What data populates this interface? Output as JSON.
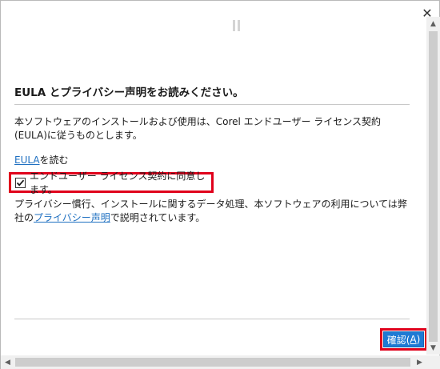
{
  "window": {
    "close_glyph": "✕"
  },
  "heading": "EULA とプライバシー声明をお読みください。",
  "description": "本ソフトウェアのインストールおよび使用は、Corel エンドユーザー ライセンス契約 (EULA)に従うものとします。",
  "eula_link": {
    "link_text": "EULA",
    "suffix": "を読む"
  },
  "agree": {
    "label": "エンドユーザー ライセンス契約に同意します。",
    "checked": true
  },
  "privacy": {
    "prefix": "プライバシー慣行、インストールに関するデータ処理、本ソフトウェアの利用については弊社の",
    "link_text": "プライバシー声明",
    "suffix": "で説明されています。"
  },
  "confirm_button": {
    "label": "確認(",
    "accelerator": "A",
    "close": ")"
  },
  "colors": {
    "accent": "#1e7ad4",
    "highlight": "#e0001b",
    "link": "#1f70c1"
  }
}
